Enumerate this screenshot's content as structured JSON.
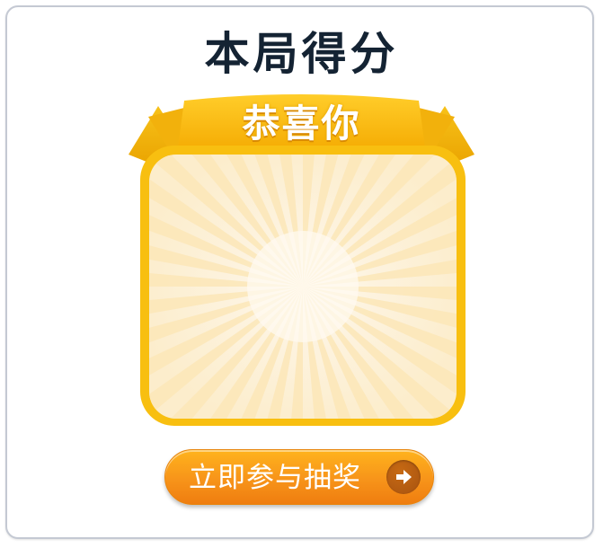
{
  "dialog": {
    "title": "本局得分",
    "ribbon_text": "恭喜你",
    "button_label": "立即参与抽奖",
    "button_icon": "arrow-right-icon"
  },
  "colors": {
    "title": "#142333",
    "gold": "#f7b80e",
    "gold_dark": "#f0a400",
    "panel_bg": "#fdf3de",
    "ray": "#fbe6b7",
    "button": "#f7941a",
    "arrow_circle": "#b35a11"
  }
}
